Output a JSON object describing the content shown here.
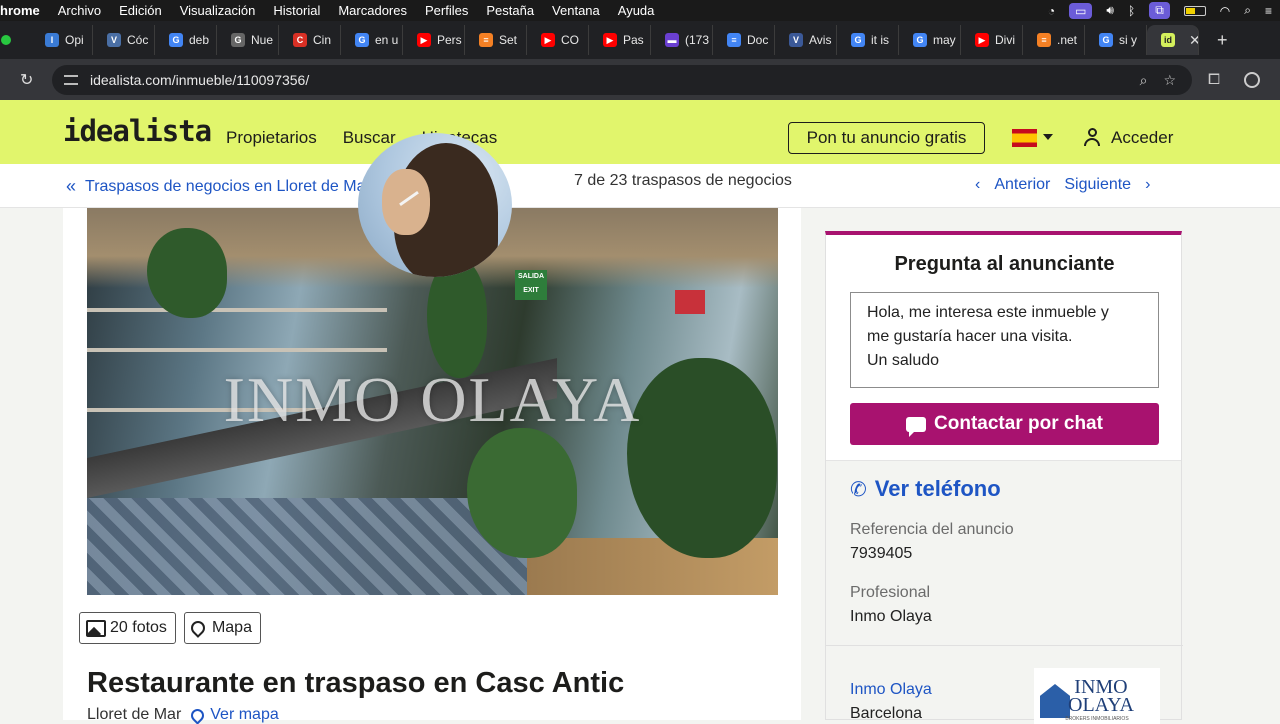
{
  "menubar": {
    "app": "hrome",
    "items": [
      "Archivo",
      "Edición",
      "Visualización",
      "Historial",
      "Marcadores",
      "Perfiles",
      "Pestaña",
      "Ventana",
      "Ayuda"
    ]
  },
  "tabs": [
    {
      "label": "Opi",
      "fav": "l",
      "color": "#3a7bd5"
    },
    {
      "label": "Cóc",
      "fav": "V",
      "color": "#4a6fa5"
    },
    {
      "label": "deb",
      "fav": "G",
      "color": "#4285f4"
    },
    {
      "label": "Nue",
      "fav": "G",
      "color": "#666666"
    },
    {
      "label": "Cin",
      "fav": "C",
      "color": "#d93025"
    },
    {
      "label": "en u",
      "fav": "G",
      "color": "#4285f4"
    },
    {
      "label": "Pers",
      "fav": "▶",
      "color": "#ff0000"
    },
    {
      "label": "Set",
      "fav": "≡",
      "color": "#f48024"
    },
    {
      "label": "CO",
      "fav": "▶",
      "color": "#ff0000"
    },
    {
      "label": "Pas",
      "fav": "▶",
      "color": "#ff0000"
    },
    {
      "label": "(173",
      "fav": "▬",
      "color": "#6a3fd1"
    },
    {
      "label": "Doc",
      "fav": "≡",
      "color": "#4285f4"
    },
    {
      "label": "Avis",
      "fav": "V",
      "color": "#3b5998"
    },
    {
      "label": "it is",
      "fav": "G",
      "color": "#4285f4"
    },
    {
      "label": "may",
      "fav": "G",
      "color": "#4285f4"
    },
    {
      "label": "Divi",
      "fav": "▶",
      "color": "#ff0000"
    },
    {
      "label": ".net",
      "fav": "≡",
      "color": "#f48024"
    },
    {
      "label": "si y",
      "fav": "G",
      "color": "#4285f4"
    }
  ],
  "active_tab": {
    "fav": "id"
  },
  "address": {
    "url": "idealista.com/inmueble/110097356/"
  },
  "header": {
    "logo": "idealista",
    "nav": [
      "Propietarios",
      "Buscar",
      "Hipotecas"
    ],
    "cta": "Pon tu anuncio gratis",
    "login": "Acceder"
  },
  "subnav": {
    "back": "Traspasos de negocios en Lloret de Mar",
    "counter": "7 de 23 traspasos de negocios",
    "prev": "Anterior",
    "next": "Siguiente"
  },
  "gallery": {
    "watermark": "INMO OLAYA",
    "photos_btn": "20 fotos",
    "map_btn": "Mapa"
  },
  "listing": {
    "title": "Restaurante en traspaso en Casc Antic",
    "location": "Lloret de Mar",
    "map_link": "Ver mapa"
  },
  "contact": {
    "heading": "Pregunta al anunciante",
    "message": "Hola, me interesa este inmueble y\nme gustaría hacer una visita.\nUn saludo",
    "chat_btn": "Contactar por chat",
    "phone": "Ver teléfono",
    "ref_label": "Referencia del anuncio",
    "ref_value": "7939405",
    "pro_label": "Profesional",
    "pro_value": "Inmo Olaya",
    "agency_link": "Inmo Olaya",
    "agency_city": "Barcelona",
    "logo_text": "INMO\nOLAYA",
    "logo_tag": "BROKERS INMOBILIARIOS"
  },
  "colors": {
    "brand_yellow": "#e1f56c",
    "accent": "#a8126f",
    "link": "#1e55c4"
  }
}
